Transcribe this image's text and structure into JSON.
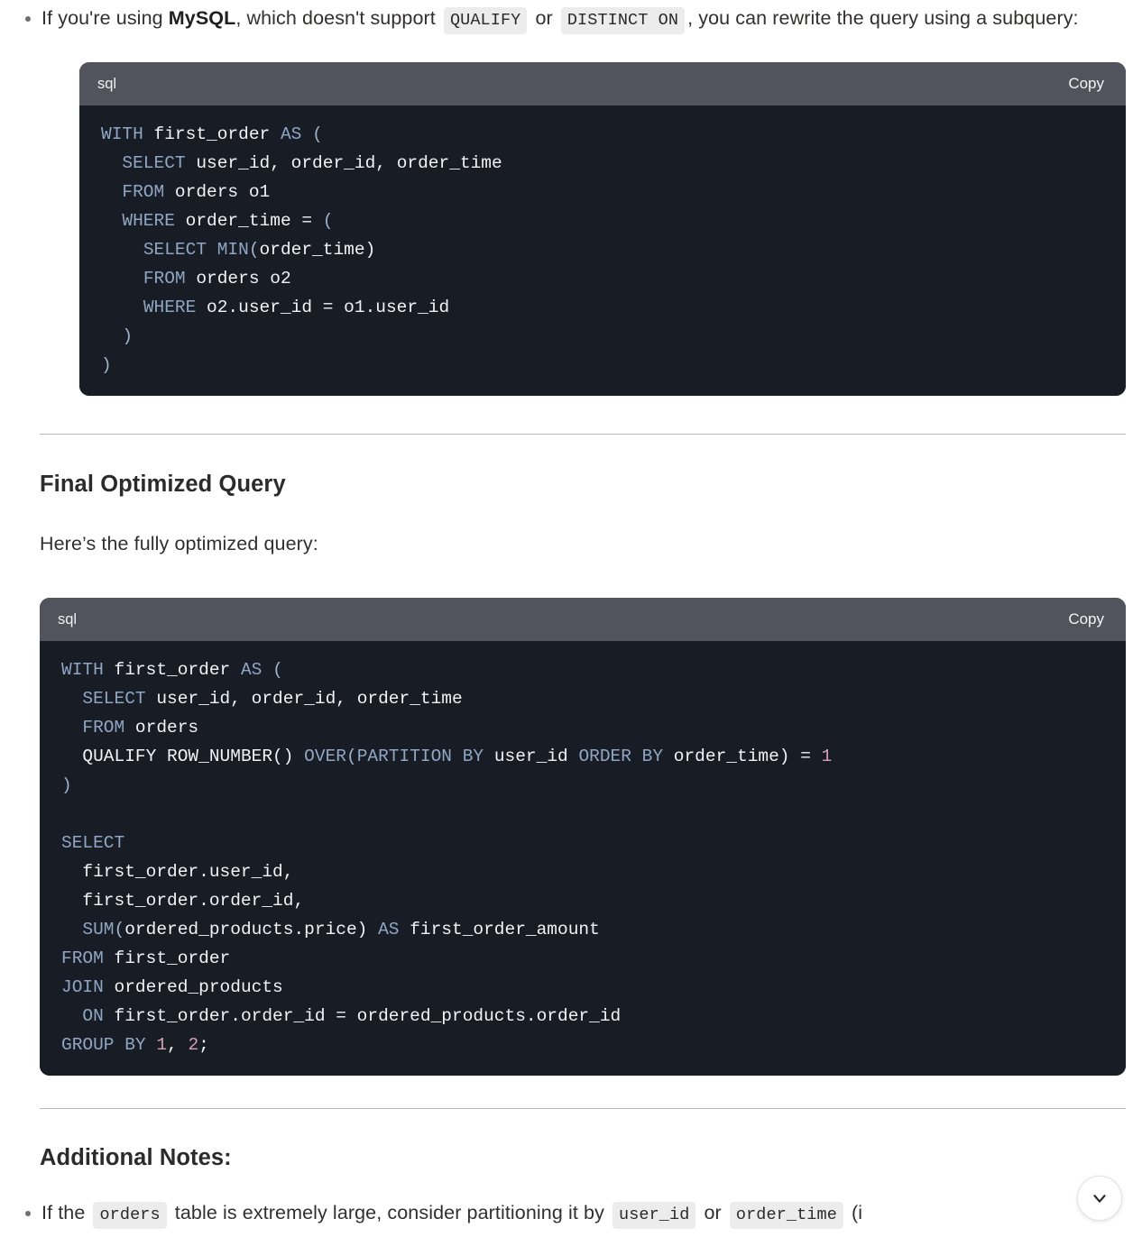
{
  "intro_bullet": {
    "text_1": "If you're using ",
    "bold": "MySQL",
    "text_2": ", which doesn't support ",
    "code_1": "QUALIFY",
    "text_3": " or ",
    "code_2": "DISTINCT ON",
    "text_4": ", you can rewrite the query using a subquery:"
  },
  "code_block_1": {
    "language": "sql",
    "copy_label": "Copy",
    "lines": [
      "WITH first_order AS (",
      "  SELECT user_id, order_id, order_time",
      "  FROM orders o1",
      "  WHERE order_time = (",
      "    SELECT MIN(order_time)",
      "    FROM orders o2",
      "    WHERE o2.user_id = o1.user_id",
      "  )",
      ")"
    ]
  },
  "final_section": {
    "heading": "Final Optimized Query",
    "paragraph": "Here’s the fully optimized query:"
  },
  "code_block_2": {
    "language": "sql",
    "copy_label": "Copy",
    "lines": [
      "WITH first_order AS (",
      "  SELECT user_id, order_id, order_time",
      "  FROM orders",
      "  QUALIFY ROW_NUMBER() OVER(PARTITION BY user_id ORDER BY order_time) = 1",
      ")",
      "",
      "SELECT",
      "  first_order.user_id,",
      "  first_order.order_id,",
      "  SUM(ordered_products.price) AS first_order_amount",
      "FROM first_order",
      "JOIN ordered_products",
      "  ON first_order.order_id = ordered_products.order_id",
      "GROUP BY 1, 2;"
    ]
  },
  "notes_section": {
    "heading": "Additional Notes:",
    "bullet": {
      "text_1": "If the ",
      "code_1": "orders",
      "text_2": " table is extremely large, consider partitioning it by ",
      "code_2": "user_id",
      "text_3": " or ",
      "code_3": "order_time",
      "text_4": " (i"
    }
  },
  "scroll_button": {
    "icon": "chevron-down-icon"
  },
  "colors": {
    "code_header_bg": "#53535e",
    "code_body_bg": "#181c25",
    "keyword": "#8fa6c4",
    "identifier": "#f0f3f8",
    "punctuation_accent": "#d16e7e",
    "number": "#d6a0b8",
    "inline_code_bg": "#ececec",
    "divider": "#b9b9b9"
  }
}
